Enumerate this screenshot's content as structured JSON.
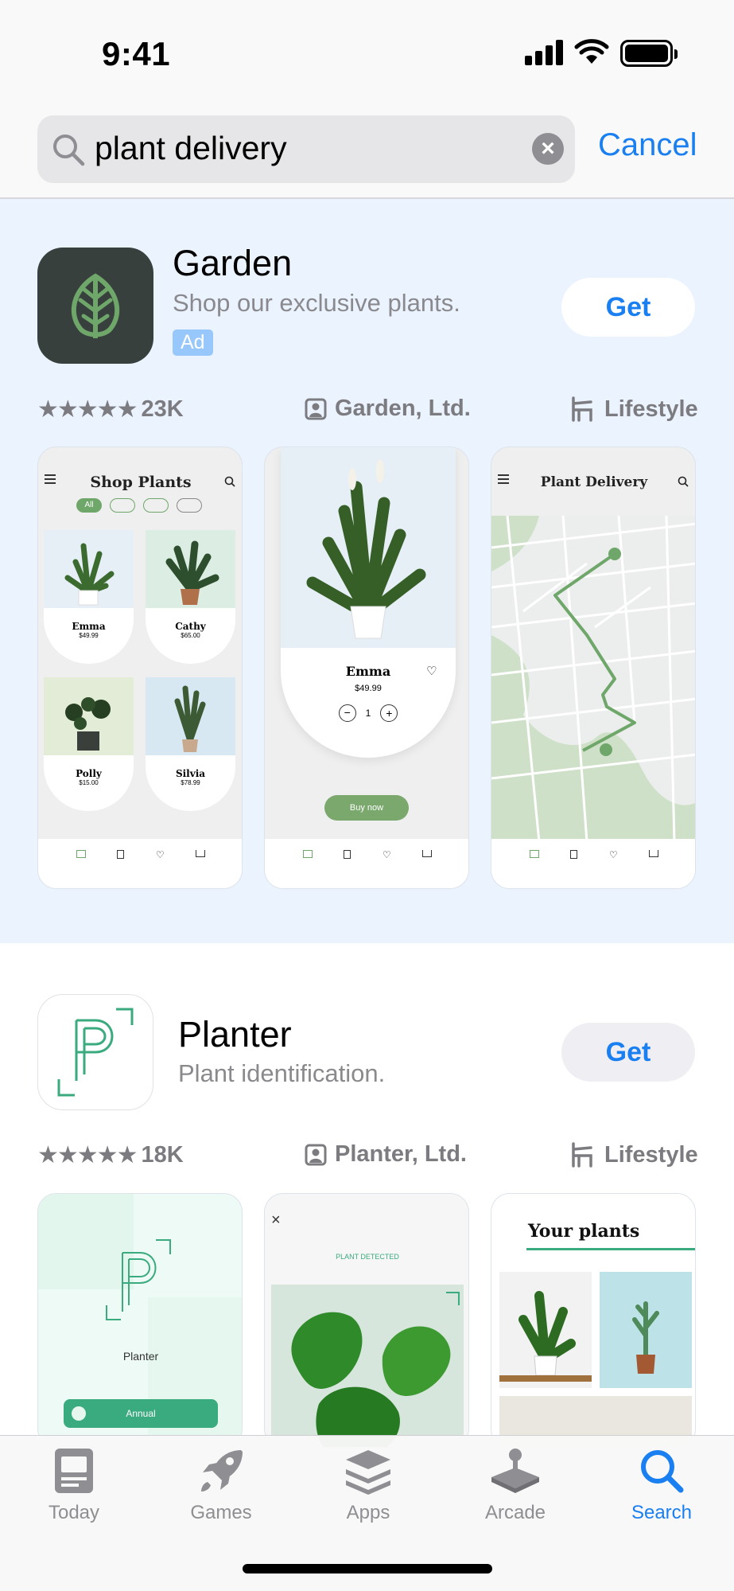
{
  "status": {
    "time": "9:41"
  },
  "search": {
    "query": "plant delivery",
    "cancel_label": "Cancel"
  },
  "results": [
    {
      "name": "Garden",
      "subtitle": "Shop our exclusive plants.",
      "badge": "Ad",
      "get_label": "Get",
      "rating_count": "23K",
      "developer": "Garden, Ltd.",
      "category": "Lifestyle",
      "screens": {
        "shop_title": "Shop Plants",
        "filter_all": "All",
        "plants": [
          {
            "name": "Emma",
            "price": "$49.99"
          },
          {
            "name": "Cathy",
            "price": "$65.00"
          },
          {
            "name": "Polly",
            "price": "$15.00"
          },
          {
            "name": "Silvia",
            "price": "$78.99"
          }
        ],
        "detail_name": "Emma",
        "detail_price": "$49.99",
        "detail_qty": "1",
        "buy_now": "Buy now",
        "delivery_title": "Plant Delivery"
      }
    },
    {
      "name": "Planter",
      "subtitle": "Plant identification.",
      "get_label": "Get",
      "rating_count": "18K",
      "developer": "Planter, Ltd.",
      "category": "Lifestyle",
      "screens": {
        "logo_letter": "P",
        "logo_word": "Planter",
        "annual": "Annual",
        "detected": "PLANT DETECTED",
        "your_plants": "Your plants"
      }
    }
  ],
  "tabs": [
    {
      "label": "Today",
      "icon": "today-icon"
    },
    {
      "label": "Games",
      "icon": "rocket-icon"
    },
    {
      "label": "Apps",
      "icon": "apps-stack-icon"
    },
    {
      "label": "Arcade",
      "icon": "joystick-icon"
    },
    {
      "label": "Search",
      "icon": "search-icon"
    }
  ],
  "colors": {
    "accent": "#1a7ff0",
    "ad_bg": "#ebf3fe",
    "garden_icon": "#37403d",
    "plant_green": "#6fa76a",
    "planter_green": "#3aaa7f"
  }
}
